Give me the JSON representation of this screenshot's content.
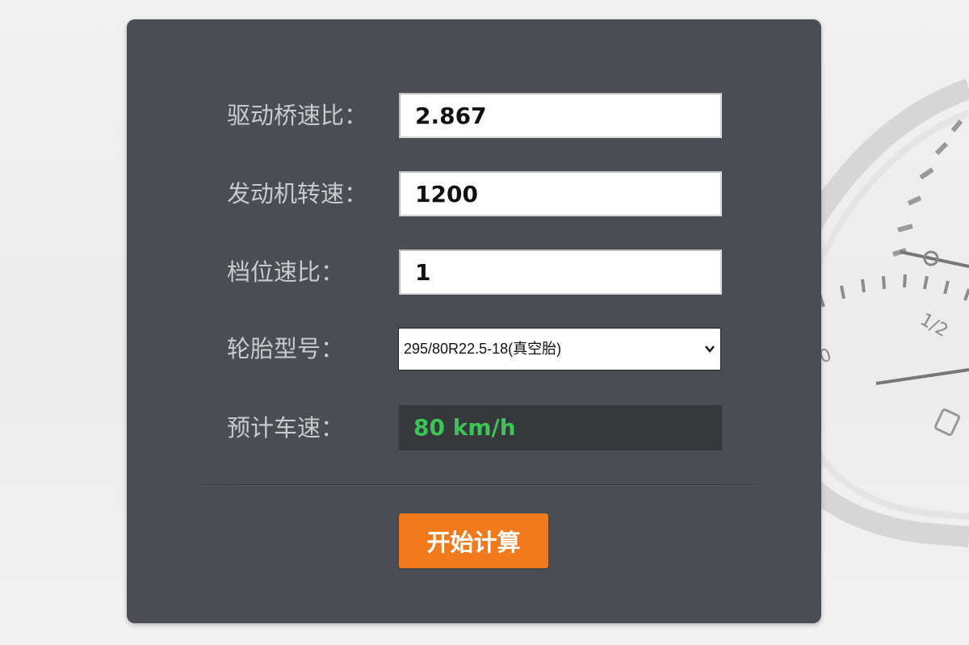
{
  "form": {
    "axle_ratio": {
      "label": "驱动桥速比：",
      "value": "2.867"
    },
    "engine_speed": {
      "label": "发动机转速：",
      "value": "1200"
    },
    "gear_ratio": {
      "label": "档位速比：",
      "value": "1"
    },
    "tire_model": {
      "label": "轮胎型号：",
      "selected": "295/80R22.5-18(真空胎)",
      "icon": "chevron-down-icon"
    },
    "estimated_speed": {
      "label": "预计车速：",
      "value": "80 km/h",
      "color": "#3cc455"
    }
  },
  "actions": {
    "calculate_label": "开始计算",
    "calculate_color": "#f07a1c"
  },
  "background": {
    "gauge_labels": [
      "1/2",
      "0"
    ]
  }
}
